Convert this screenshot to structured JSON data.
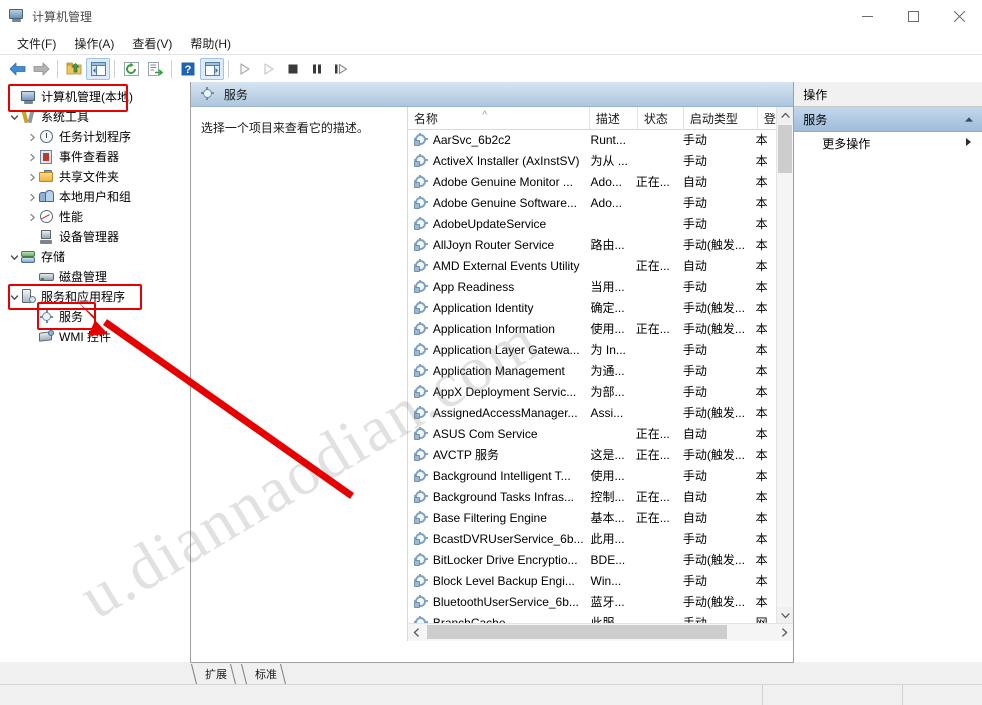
{
  "window": {
    "title": "计算机管理",
    "icon": "computer-management-icon",
    "controls": {
      "minimize": "minimize-icon",
      "maximize": "maximize-icon",
      "close": "close-icon"
    }
  },
  "menu": {
    "items": [
      {
        "label": "文件(F)"
      },
      {
        "label": "操作(A)"
      },
      {
        "label": "查看(V)"
      },
      {
        "label": "帮助(H)"
      }
    ]
  },
  "toolbar": {
    "buttons": [
      {
        "name": "back-arrow-icon",
        "glyph": "◀"
      },
      {
        "name": "forward-arrow-icon",
        "glyph": "▶"
      },
      {
        "name": "up-folder-icon",
        "glyph": ""
      },
      {
        "name": "show-hide-console-tree-icon",
        "glyph": ""
      },
      {
        "name": "refresh-icon",
        "glyph": ""
      },
      {
        "name": "export-list-icon",
        "glyph": ""
      },
      {
        "name": "help-icon",
        "glyph": "?"
      },
      {
        "name": "show-hide-action-pane-icon",
        "glyph": ""
      },
      {
        "name": "start-service-icon",
        "glyph": "▶"
      },
      {
        "name": "resume-service-icon",
        "glyph": "▷"
      },
      {
        "name": "stop-service-icon",
        "glyph": "■"
      },
      {
        "name": "pause-service-icon",
        "glyph": "❚❚"
      },
      {
        "name": "restart-service-icon",
        "glyph": "❚▷"
      }
    ]
  },
  "tree": {
    "items": [
      {
        "label": "计算机管理(本地)",
        "indent": 0,
        "expander": "none",
        "icon": "computer-icon",
        "selected": false,
        "highlighted": true
      },
      {
        "label": "系统工具",
        "indent": 1,
        "expander": "expanded",
        "icon": "system-tools-icon",
        "selected": false,
        "highlighted": false
      },
      {
        "label": "任务计划程序",
        "indent": 2,
        "expander": "collapsed",
        "icon": "task-scheduler-icon",
        "selected": false,
        "highlighted": false
      },
      {
        "label": "事件查看器",
        "indent": 2,
        "expander": "collapsed",
        "icon": "event-viewer-icon",
        "selected": false,
        "highlighted": false
      },
      {
        "label": "共享文件夹",
        "indent": 2,
        "expander": "collapsed",
        "icon": "shared-folders-icon",
        "selected": false,
        "highlighted": false
      },
      {
        "label": "本地用户和组",
        "indent": 2,
        "expander": "collapsed",
        "icon": "local-users-groups-icon",
        "selected": false,
        "highlighted": false
      },
      {
        "label": "性能",
        "indent": 2,
        "expander": "collapsed",
        "icon": "performance-icon",
        "selected": false,
        "highlighted": false
      },
      {
        "label": "设备管理器",
        "indent": 2,
        "expander": "none",
        "icon": "device-manager-icon",
        "selected": false,
        "highlighted": false
      },
      {
        "label": "存储",
        "indent": 1,
        "expander": "expanded",
        "icon": "storage-icon",
        "selected": false,
        "highlighted": false
      },
      {
        "label": "磁盘管理",
        "indent": 2,
        "expander": "none",
        "icon": "disk-management-icon",
        "selected": false,
        "highlighted": false
      },
      {
        "label": "服务和应用程序",
        "indent": 1,
        "expander": "expanded",
        "icon": "services-applications-icon",
        "selected": false,
        "highlighted": true
      },
      {
        "label": "服务",
        "indent": 2,
        "expander": "none",
        "icon": "services-gear-icon",
        "selected": true,
        "highlighted": true
      },
      {
        "label": "WMI 控件",
        "indent": 2,
        "expander": "none",
        "icon": "wmi-control-icon",
        "selected": false,
        "highlighted": false
      }
    ]
  },
  "banner": {
    "title": "服务",
    "icon": "services-gear-icon"
  },
  "description_pane": {
    "text": "选择一个项目来查看它的描述。"
  },
  "list": {
    "columns": [
      {
        "label": "名称",
        "sort": "asc"
      },
      {
        "label": "描述",
        "sort": "none"
      },
      {
        "label": "状态",
        "sort": "none"
      },
      {
        "label": "启动类型",
        "sort": "none"
      },
      {
        "label": "登",
        "sort": "none"
      }
    ],
    "sort_caret": "^",
    "rows": [
      {
        "name": "AarSvc_6b2c2",
        "desc": "Runt...",
        "status": "",
        "startup": "手动",
        "logon": "本"
      },
      {
        "name": "ActiveX Installer (AxInstSV)",
        "desc": "为从 ...",
        "status": "",
        "startup": "手动",
        "logon": "本"
      },
      {
        "name": "Adobe Genuine Monitor ...",
        "desc": "Ado...",
        "status": "正在...",
        "startup": "自动",
        "logon": "本"
      },
      {
        "name": "Adobe Genuine Software...",
        "desc": "Ado...",
        "status": "",
        "startup": "手动",
        "logon": "本"
      },
      {
        "name": "AdobeUpdateService",
        "desc": "",
        "status": "",
        "startup": "手动",
        "logon": "本"
      },
      {
        "name": "AllJoyn Router Service",
        "desc": "路由...",
        "status": "",
        "startup": "手动(触发...",
        "logon": "本"
      },
      {
        "name": "AMD External Events Utility",
        "desc": "",
        "status": "正在...",
        "startup": "自动",
        "logon": "本"
      },
      {
        "name": "App Readiness",
        "desc": "当用...",
        "status": "",
        "startup": "手动",
        "logon": "本"
      },
      {
        "name": "Application Identity",
        "desc": "确定...",
        "status": "",
        "startup": "手动(触发...",
        "logon": "本"
      },
      {
        "name": "Application Information",
        "desc": "使用...",
        "status": "正在...",
        "startup": "手动(触发...",
        "logon": "本"
      },
      {
        "name": "Application Layer Gatewa...",
        "desc": "为 In...",
        "status": "",
        "startup": "手动",
        "logon": "本"
      },
      {
        "name": "Application Management",
        "desc": "为通...",
        "status": "",
        "startup": "手动",
        "logon": "本"
      },
      {
        "name": "AppX Deployment Servic...",
        "desc": "为部...",
        "status": "",
        "startup": "手动",
        "logon": "本"
      },
      {
        "name": "AssignedAccessManager...",
        "desc": "Assi...",
        "status": "",
        "startup": "手动(触发...",
        "logon": "本"
      },
      {
        "name": "ASUS Com Service",
        "desc": "",
        "status": "正在...",
        "startup": "自动",
        "logon": "本"
      },
      {
        "name": "AVCTP 服务",
        "desc": "这是...",
        "status": "正在...",
        "startup": "手动(触发...",
        "logon": "本"
      },
      {
        "name": "Background Intelligent T...",
        "desc": "使用...",
        "status": "",
        "startup": "手动",
        "logon": "本"
      },
      {
        "name": "Background Tasks Infras...",
        "desc": "控制...",
        "status": "正在...",
        "startup": "自动",
        "logon": "本"
      },
      {
        "name": "Base Filtering Engine",
        "desc": "基本...",
        "status": "正在...",
        "startup": "自动",
        "logon": "本"
      },
      {
        "name": "BcastDVRUserService_6b...",
        "desc": "此用...",
        "status": "",
        "startup": "手动",
        "logon": "本"
      },
      {
        "name": "BitLocker Drive Encryptio...",
        "desc": "BDE...",
        "status": "",
        "startup": "手动(触发...",
        "logon": "本"
      },
      {
        "name": "Block Level Backup Engi...",
        "desc": "Win...",
        "status": "",
        "startup": "手动",
        "logon": "本"
      },
      {
        "name": "BluetoothUserService_6b...",
        "desc": "蓝牙...",
        "status": "",
        "startup": "手动(触发...",
        "logon": "本"
      },
      {
        "name": "BranchCache",
        "desc": "此服...",
        "status": "",
        "startup": "手动",
        "logon": "网"
      }
    ]
  },
  "actions": {
    "header": "操作",
    "group": {
      "label": "服务",
      "collapse_icon": "chevron-up-icon"
    },
    "items": [
      {
        "label": "更多操作",
        "submenu_icon": "chevron-right-icon"
      }
    ]
  },
  "tabs": [
    {
      "label": "扩展",
      "active": false
    },
    {
      "label": "标准",
      "active": true
    }
  ],
  "watermark": {
    "text": "u.diannaodian.com"
  },
  "annotations": {
    "color": "#e60000",
    "boxes": [
      {
        "name": "highlight-computer-management-root"
      },
      {
        "name": "highlight-services-and-applications"
      },
      {
        "name": "highlight-services-node"
      }
    ],
    "arrow": {
      "name": "pointer-arrow-to-services"
    }
  }
}
